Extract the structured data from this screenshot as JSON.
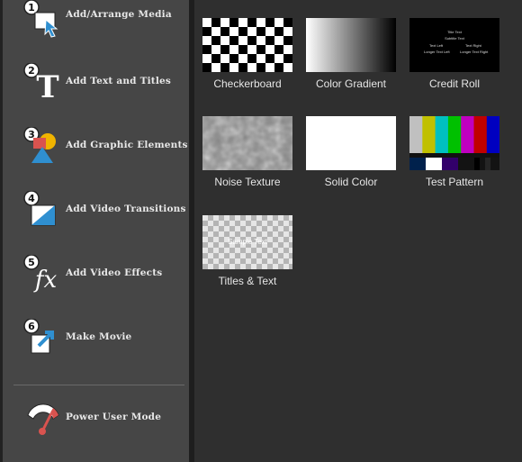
{
  "sidebar": {
    "steps": [
      {
        "num": "1",
        "label": "Add/Arrange Media"
      },
      {
        "num": "2",
        "label": "Add Text and Titles"
      },
      {
        "num": "3",
        "label": "Add Graphic Elements"
      },
      {
        "num": "4",
        "label": "Add Video Transitions"
      },
      {
        "num": "5",
        "label": "Add Video Effects"
      },
      {
        "num": "6",
        "label": "Make Movie"
      }
    ],
    "power_user": {
      "label": "Power User Mode"
    }
  },
  "tiles": [
    {
      "caption": "Checkerboard"
    },
    {
      "caption": "Color Gradient"
    },
    {
      "caption": "Credit Roll",
      "preview": {
        "title": "Title Text",
        "subtitle": "Subtitle Text",
        "left": "Text Left",
        "right": "Text Right",
        "long_left": "Longer Text Left",
        "long_right": "Longer Text Right"
      }
    },
    {
      "caption": "Noise Texture"
    },
    {
      "caption": "Solid Color"
    },
    {
      "caption": "Test Pattern"
    },
    {
      "caption": "Titles & Text",
      "preview": {
        "sample": "Sample Text"
      }
    }
  ],
  "colors": {
    "sidebar_bg": "#464646",
    "main_bg": "#2f2f2f",
    "accent_blue": "#2f8fd0",
    "accent_red": "#d9534f"
  }
}
